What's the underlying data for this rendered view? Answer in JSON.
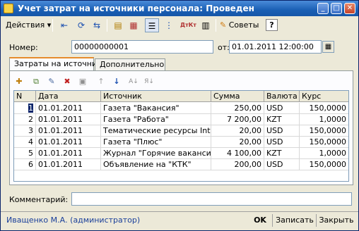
{
  "window": {
    "title": "Учет затрат на источники персонала: Проведен",
    "controls": {
      "minimize": "_",
      "maximize": "□",
      "close": "✕"
    }
  },
  "toolbar": {
    "actions_label": "Действия",
    "advice_label": "Советы",
    "help_label": "?"
  },
  "form": {
    "number_label": "Номер:",
    "number_value": "00000000001",
    "date_label": "от:",
    "date_value": "01.01.2011 12:00:00"
  },
  "tabs": [
    {
      "label": "Затраты на источники"
    },
    {
      "label": "Дополнительно"
    }
  ],
  "table": {
    "columns": [
      "N",
      "Дата",
      "Источник",
      "Сумма",
      "Валюта",
      "Курс"
    ],
    "rows": [
      {
        "n": "1",
        "date": "01.01.2011",
        "source": "Газета \"Вакансия\"",
        "sum": "250,00",
        "currency": "USD",
        "rate": "150,0000"
      },
      {
        "n": "2",
        "date": "01.01.2011",
        "source": "Газета \"Работа\"",
        "sum": "7 200,00",
        "currency": "KZT",
        "rate": "1,0000"
      },
      {
        "n": "3",
        "date": "01.01.2011",
        "source": "Тематические ресурсы Inter...",
        "sum": "20,00",
        "currency": "USD",
        "rate": "150,0000"
      },
      {
        "n": "4",
        "date": "01.01.2011",
        "source": "Газета \"Плюс\"",
        "sum": "20,00",
        "currency": "USD",
        "rate": "150,0000"
      },
      {
        "n": "5",
        "date": "01.01.2011",
        "source": "Журнал \"Горячие вакансии\"",
        "sum": "4 100,00",
        "currency": "KZT",
        "rate": "1,0000"
      },
      {
        "n": "6",
        "date": "01.01.2011",
        "source": "Объявление на \"КТК\"",
        "sum": "200,00",
        "currency": "USD",
        "rate": "150,0000"
      }
    ]
  },
  "comment": {
    "label": "Комментарий:",
    "value": ""
  },
  "footer": {
    "user": "Иващенко М.А. (администратор)",
    "ok_label": "OK",
    "save_label": "Записать",
    "close_label": "Закрыть"
  }
}
